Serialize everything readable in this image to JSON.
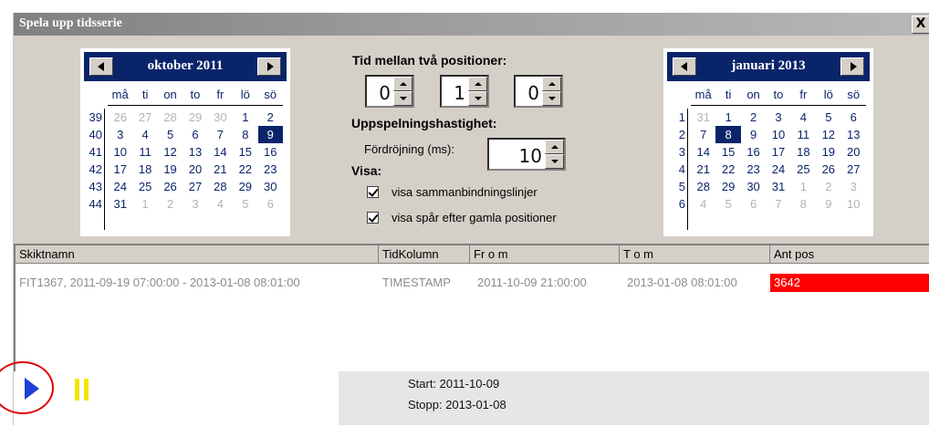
{
  "window": {
    "title": "Spela upp tidsserie",
    "close_label": "X"
  },
  "calendar_left": {
    "month": "oktober 2011",
    "dow": [
      "må",
      "ti",
      "on",
      "to",
      "fr",
      "lö",
      "sö"
    ],
    "weeks": [
      "39",
      "40",
      "41",
      "42",
      "43",
      "44"
    ],
    "rows": [
      [
        "26",
        "27",
        "28",
        "29",
        "30",
        "1",
        "2"
      ],
      [
        "3",
        "4",
        "5",
        "6",
        "7",
        "8",
        "9"
      ],
      [
        "10",
        "11",
        "12",
        "13",
        "14",
        "15",
        "16"
      ],
      [
        "17",
        "18",
        "19",
        "20",
        "21",
        "22",
        "23"
      ],
      [
        "24",
        "25",
        "26",
        "27",
        "28",
        "29",
        "30"
      ],
      [
        "31",
        "1",
        "2",
        "3",
        "4",
        "5",
        "6"
      ]
    ],
    "selected": "9"
  },
  "calendar_right": {
    "month": "januari 2013",
    "dow": [
      "må",
      "ti",
      "on",
      "to",
      "fr",
      "lö",
      "sö"
    ],
    "weeks": [
      "1",
      "2",
      "3",
      "4",
      "5",
      "6"
    ],
    "rows": [
      [
        "31",
        "1",
        "2",
        "3",
        "4",
        "5",
        "6"
      ],
      [
        "7",
        "8",
        "9",
        "10",
        "11",
        "12",
        "13"
      ],
      [
        "14",
        "15",
        "16",
        "17",
        "18",
        "19",
        "20"
      ],
      [
        "21",
        "22",
        "23",
        "24",
        "25",
        "26",
        "27"
      ],
      [
        "28",
        "29",
        "30",
        "31",
        "1",
        "2",
        "3"
      ],
      [
        "4",
        "5",
        "6",
        "7",
        "8",
        "9",
        "10"
      ]
    ],
    "selected": "8"
  },
  "controls": {
    "time_between_label": "Tid mellan två positioner:",
    "spin_values": [
      "0",
      "1",
      "0"
    ],
    "speed_label": "Uppspelningshastighet:",
    "delay_label": "Fördröjning (ms):",
    "delay_value": "10",
    "show_label": "Visa:",
    "check1_label": "visa sammanbindningslinjer",
    "check2_label": "visa spår efter gamla positioner"
  },
  "list": {
    "columns": [
      "Skiktnamn",
      "TidKolumn",
      "Fr o m",
      "T o m",
      "Ant pos"
    ],
    "rows": [
      [
        "FIT1367, 2011-09-19 07:00:00 - 2013-01-08 08:01:00",
        "TIMESTAMP",
        "2011-10-09 21:00:00",
        "2013-01-08 08:01:00",
        "3642"
      ]
    ]
  },
  "status": {
    "start": "Start:  2011-10-09",
    "stop": "Stopp: 2013-01-08"
  },
  "colors": {
    "highlight": "#ff0000",
    "calendar_header": "#0a246a",
    "play": "#1f3fd8",
    "pause": "#f5e300"
  }
}
